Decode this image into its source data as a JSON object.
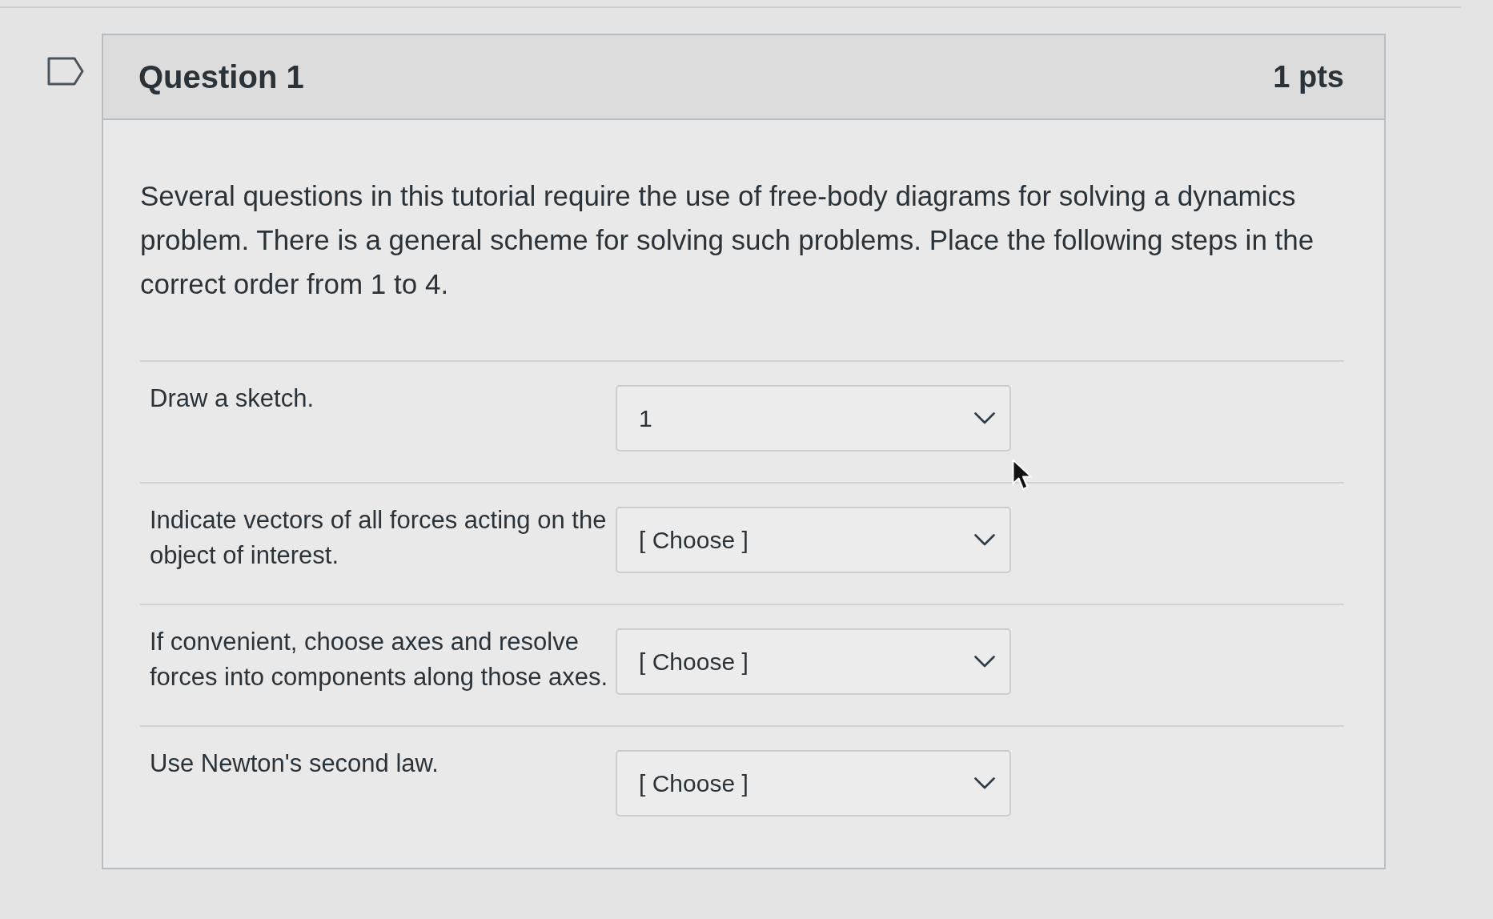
{
  "question": {
    "title": "Question 1",
    "points": "1 pts",
    "flagged": false
  },
  "prompt": "Several questions in this tutorial require the use of free-body diagrams for solving a dynamics problem. There is a general scheme for solving such problems. Place the following steps in the correct order from 1 to 4.",
  "steps": [
    {
      "label": "Draw a sketch.",
      "answer": "1"
    },
    {
      "label": "Indicate vectors of all forces acting on the object of interest.",
      "answer": "[ Choose ]"
    },
    {
      "label": "If convenient, choose axes and resolve forces into components along those axes.",
      "answer": "[ Choose ]"
    },
    {
      "label": "Use Newton's second law.",
      "answer": "[ Choose ]"
    }
  ]
}
